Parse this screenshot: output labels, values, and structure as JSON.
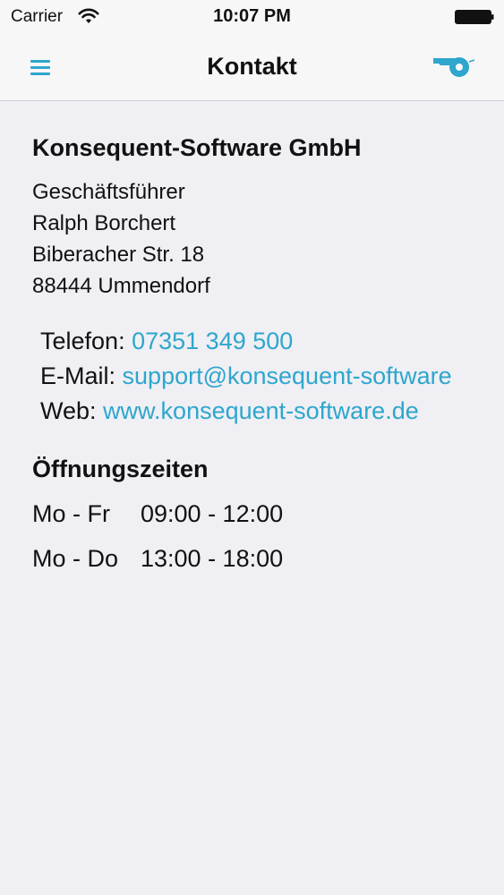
{
  "status_bar": {
    "carrier": "Carrier",
    "time": "10:07 PM"
  },
  "nav": {
    "title": "Kontakt",
    "left_icon": "hamburger-menu-icon",
    "right_icon": "whistle-icon",
    "accent_color": "#2ea6cd"
  },
  "company": {
    "name": "Konsequent-Software GmbH",
    "address_lines": [
      "Geschäftsführer",
      "Ralph Borchert",
      "Biberacher Str. 18",
      "88444 Ummendorf"
    ]
  },
  "contact": {
    "phone_label": "Telefon:",
    "phone_value": "07351 349 500",
    "email_label": "E-Mail:",
    "email_value": "support@konsequent-software",
    "web_label": "Web:",
    "web_value": "www.konsequent-software.de",
    "link_color": "#2ea6cd"
  },
  "hours": {
    "title": "Öffnungszeiten",
    "rows": [
      {
        "days": "Mo - Fr",
        "time": "09:00 - 12:00"
      },
      {
        "days": "Mo - Do",
        "time": "13:00 - 18:00"
      }
    ]
  }
}
